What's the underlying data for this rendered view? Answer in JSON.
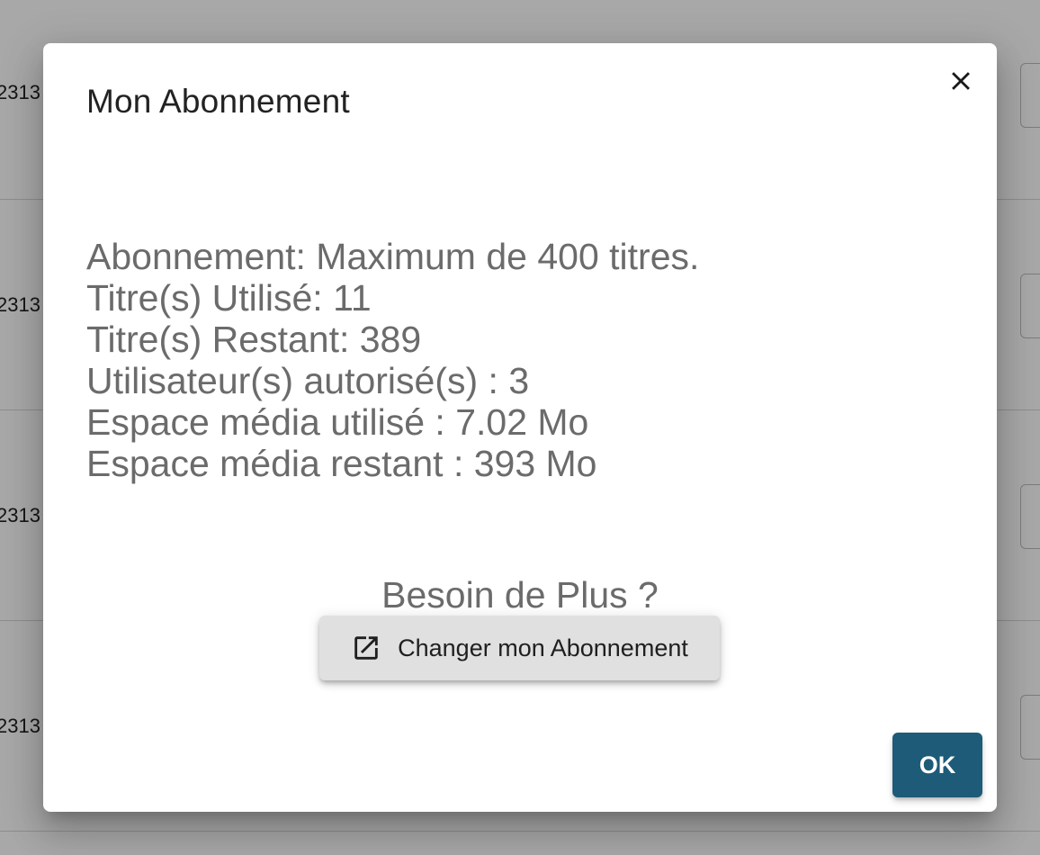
{
  "background": {
    "rows": [
      {
        "text": "2313"
      },
      {
        "text": "2313"
      },
      {
        "text": "2313"
      },
      {
        "text": "2313"
      }
    ]
  },
  "dialog": {
    "title": "Mon Abonnement",
    "info_lines": [
      "Abonnement: Maximum de 400 titres.",
      "Titre(s) Utilisé: 11",
      "Titre(s) Restant: 389",
      "Utilisateur(s) autorisé(s) : 3",
      "Espace média utilisé : 7.02 Mo",
      "Espace média restant : 393 Mo"
    ],
    "need_more": "Besoin de Plus ?",
    "change_button_label": "Changer mon Abonnement",
    "ok_label": "OK",
    "icons": {
      "close": "close-icon",
      "change": "open-in-new-icon"
    }
  },
  "colors": {
    "primary": "#1d5b78",
    "secondary_button": "#e0e0e0",
    "body_text": "#6b6b6b",
    "title_text": "#222222"
  }
}
